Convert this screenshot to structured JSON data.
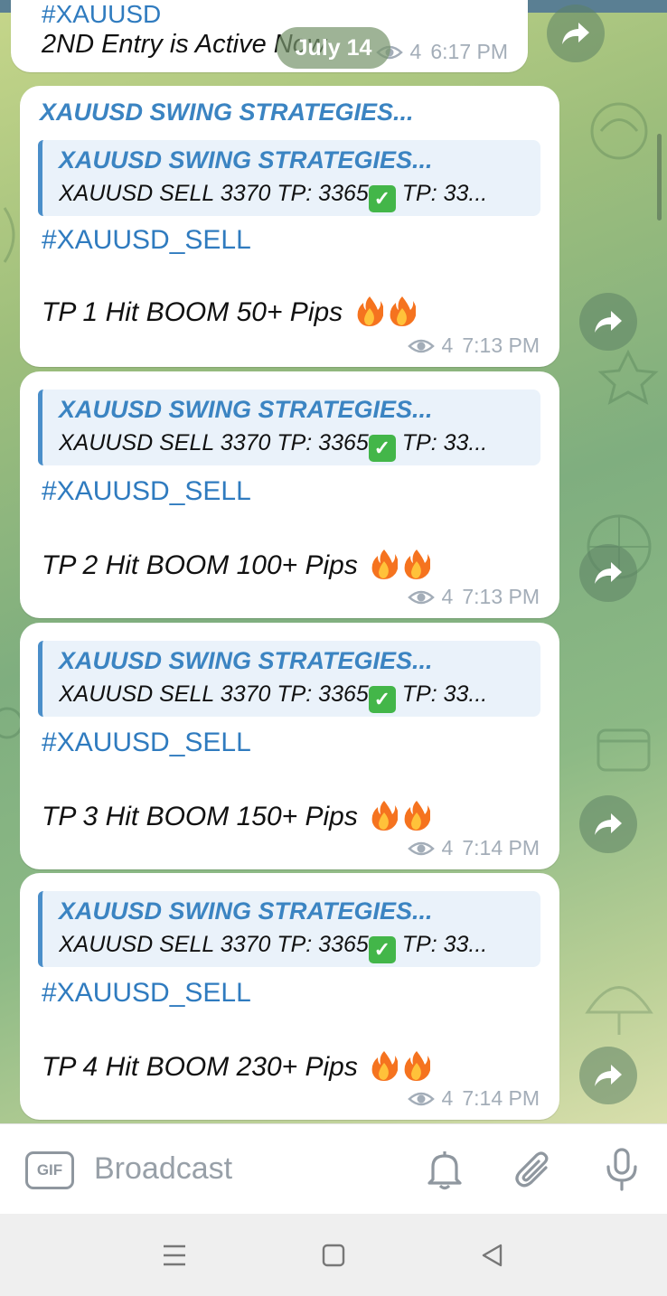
{
  "header": {
    "date_pill": "July 14"
  },
  "first_message": {
    "hashtag_partial": "#XAUUSD",
    "text": "2ND Entry is Active Now",
    "views": "4",
    "time": "6:17 PM"
  },
  "channel_name": "XAUUSD SWING STRATEGIES...",
  "messages": [
    {
      "quote_title": "XAUUSD SWING STRATEGIES...",
      "quote_text_a": "XAUUSD SELL 3370  TP: 3365",
      "quote_text_b": " TP: 33...",
      "hashtag": "#XAUUSD_SELL",
      "text": "TP 1 Hit BOOM 50+ Pips",
      "views": "4",
      "time": "7:13 PM"
    },
    {
      "quote_title": "XAUUSD SWING STRATEGIES...",
      "quote_text_a": "XAUUSD SELL 3370  TP: 3365",
      "quote_text_b": " TP: 33...",
      "hashtag": "#XAUUSD_SELL",
      "text": "TP 2 Hit BOOM 100+ Pips",
      "views": "4",
      "time": "7:13 PM"
    },
    {
      "quote_title": "XAUUSD SWING STRATEGIES...",
      "quote_text_a": "XAUUSD SELL 3370  TP: 3365",
      "quote_text_b": " TP: 33...",
      "hashtag": "#XAUUSD_SELL",
      "text": "TP 3 Hit BOOM 150+ Pips",
      "views": "4",
      "time": "7:14 PM"
    },
    {
      "quote_title": "XAUUSD SWING STRATEGIES...",
      "quote_text_a": "XAUUSD SELL 3370  TP: 3365",
      "quote_text_b": " TP: 33...",
      "hashtag": "#XAUUSD_SELL",
      "text": "TP 4 Hit BOOM 230+ Pips",
      "views": "4",
      "time": "7:14 PM"
    }
  ],
  "input_bar": {
    "gif_label": "GIF",
    "placeholder": "Broadcast",
    "icons": [
      "bell-icon",
      "paperclip-icon",
      "microphone-icon"
    ]
  },
  "nav_bar": {
    "icons": [
      "menu-icon",
      "home-square-icon",
      "back-triangle-icon"
    ]
  },
  "colors": {
    "link_blue": "#3b84c2",
    "hashtag_blue": "#2f7bbf",
    "meta_gray": "#a3adb8",
    "check_green": "#43b649"
  }
}
